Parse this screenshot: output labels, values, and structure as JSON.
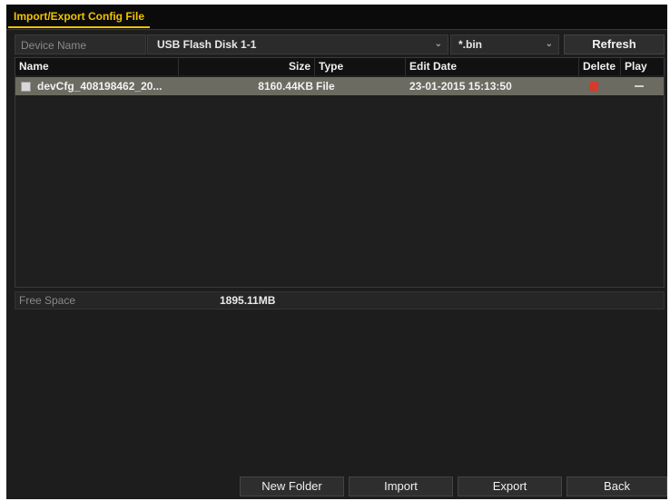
{
  "tab": {
    "label": "Import/Export Config File"
  },
  "device": {
    "label": "Device Name",
    "selected": "USB Flash Disk 1-1",
    "filter": "*.bin",
    "refresh_label": "Refresh"
  },
  "table": {
    "headers": {
      "name": "Name",
      "size": "Size",
      "type": "Type",
      "edit_date": "Edit Date",
      "delete": "Delete",
      "play": "Play"
    },
    "rows": [
      {
        "name": "devCfg_408198462_20...",
        "size": "8160.44KB",
        "type": "File",
        "edit_date": "23-01-2015 15:13:50"
      }
    ]
  },
  "free_space": {
    "label": "Free Space",
    "value": "1895.11MB"
  },
  "buttons": {
    "new_folder": "New Folder",
    "import": "Import",
    "export": "Export",
    "back": "Back"
  },
  "icons": [
    "file-icon",
    "delete-icon",
    "play-icon",
    "chevron-down-icon"
  ],
  "colors": {
    "accent": "#f2c200",
    "selected_row": "#6b6b61",
    "delete": "#d63a2a"
  }
}
